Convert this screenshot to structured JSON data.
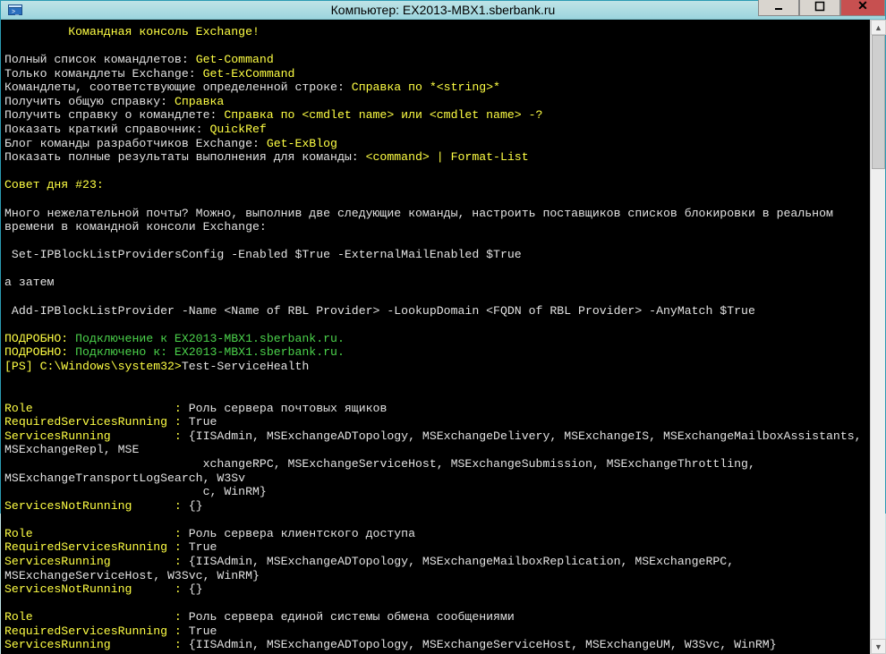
{
  "window_title": "Компьютер: EX2013-MBX1.sberbank.ru",
  "header_indent": "         ",
  "header_text": "Командная консоль Exchange!",
  "r1a": "Полный список командлетов: ",
  "r1b": "Get-Command",
  "r2a": "Только командлеты Exchange: ",
  "r2b": "Get-ExCommand",
  "r3a": "Командлеты, соответствующие определенной строке: ",
  "r3b": "Справка по *<string>*",
  "r4a": "Получить общую справку: ",
  "r4b": "Справка",
  "r5a": "Получить справку о командлете: ",
  "r5b": "Справка по <cmdlet name> или <cmdlet name> -?",
  "r6a": "Показать краткий справочник: ",
  "r6b": "QuickRef",
  "r7a": "Блог команды разработчиков Exchange: ",
  "r7b": "Get-ExBlog",
  "r8a": "Показать полные результаты выполнения для команды: ",
  "r8b": "<command> | Format-List",
  "tip_header": "Совет дня #23:",
  "tip1": "Много нежелательной почты? Можно, выполнив две следующие команды, настроить поставщиков списков блокировки в реальном времени в командной консоли Exchange:",
  "cmd1": " Set-IPBlockListProvidersConfig -Enabled $True -ExternalMailEnabled $True",
  "then": "а затем",
  "cmd2": " Add-IPBlockListProvider -Name <Name of RBL Provider> -LookupDomain <FQDN of RBL Provider> -AnyMatch $True",
  "conn1a": "ПОДРОБНО: ",
  "conn1b": "Подключение к EX2013-MBX1.sberbank.ru.",
  "conn2a": "ПОДРОБНО: ",
  "conn2b": "Подключено к: EX2013-MBX1.sberbank.ru.",
  "prompt": "[PS] C:\\Windows\\system32>",
  "typed": "Test-ServiceHealth",
  "lblRole": "Role",
  "lblReq": "RequiredServicesRunning",
  "lblRun": "ServicesRunning",
  "lblNot": "ServicesNotRunning",
  "role1": "Роль сервера почтовых ящиков",
  "role2": "Роль сервера клиентского доступа",
  "role3": "Роль сервера единой системы обмена сообщениями",
  "true_": "True",
  "svc1": "{IISAdmin, MSExchangeADTopology, MSExchangeDelivery, MSExchangeIS, MSExchangeMailboxAssistants, MSExchangeRepl, MSExchangeRPC, MSExchangeServiceHost, MSExchangeSubmission, MSExchangeThrottling, MSExchangeTransportLogSearch, W3Svc, WinRM}",
  "svc2": "{IISAdmin, MSExchangeADTopology, MSExchangeMailboxReplication, MSExchangeRPC, MSExchangeServiceHost, W3Svc, WinRM}",
  "svc3": "{IISAdmin, MSExchangeADTopology, MSExchangeServiceHost, MSExchangeUM, W3Svc, WinRM}",
  "empty": "{}"
}
